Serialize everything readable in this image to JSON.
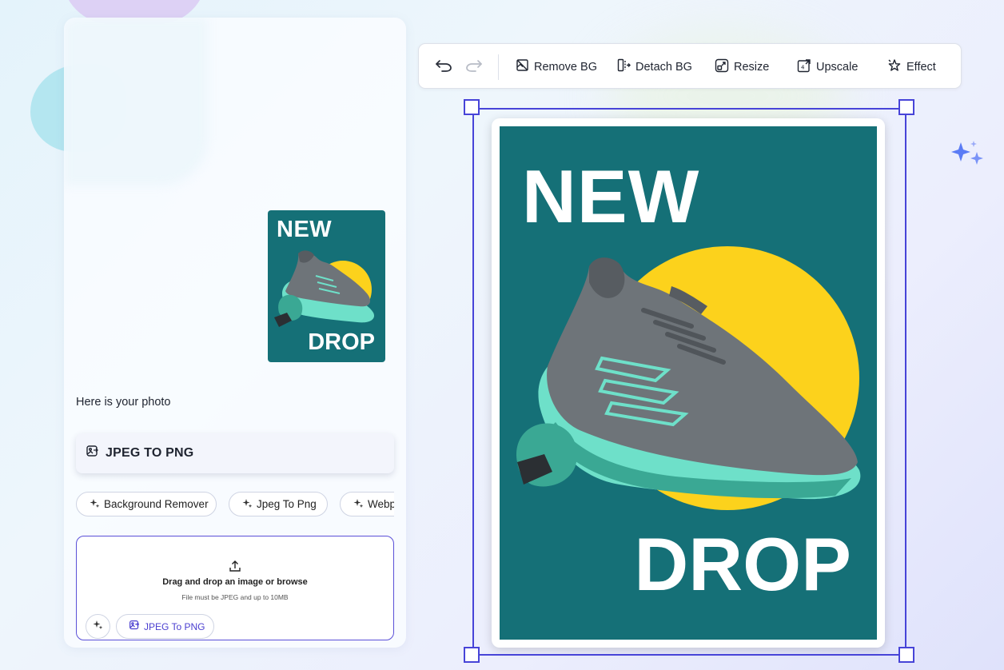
{
  "chat": {
    "caption": "Here is your photo",
    "thumbnail": {
      "headline_top": "NEW",
      "headline_bottom": "DROP"
    },
    "tool_card": {
      "label": "JPEG TO PNG",
      "icon": "image-convert-icon"
    },
    "chips": [
      {
        "label": "Background Remover",
        "icon": "sparkle-icon"
      },
      {
        "label": "Jpeg To Png",
        "icon": "sparkle-icon"
      },
      {
        "label": "Webp",
        "icon": "sparkle-icon"
      }
    ],
    "upload": {
      "title": "Drag and drop an image or browse",
      "subtitle": "File must be JPEG and up to 10MB",
      "format_button": "JPEG To PNG",
      "icon": "upload-icon"
    }
  },
  "toolbar": {
    "undo_icon": "undo-icon",
    "redo_icon": "redo-icon",
    "remove_bg": "Remove BG",
    "detach_bg": "Detach BG",
    "resize": "Resize",
    "upscale": "Upscale",
    "effect": "Effect"
  },
  "poster": {
    "headline_top": "NEW",
    "headline_bottom": "DROP",
    "background_color": "#157077",
    "circle_color": "#fcd21c",
    "accent_color": "#6ee0c9"
  },
  "colors": {
    "selection": "#4744d8",
    "accent": "#5a50d8"
  }
}
